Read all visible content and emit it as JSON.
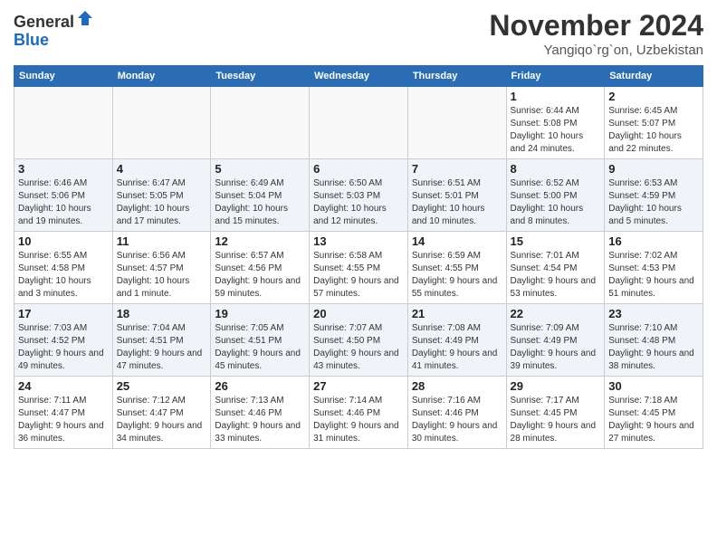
{
  "header": {
    "logo_line1": "General",
    "logo_line2": "Blue",
    "month_title": "November 2024",
    "location": "Yangiqo`rg`on, Uzbekistan"
  },
  "days_of_week": [
    "Sunday",
    "Monday",
    "Tuesday",
    "Wednesday",
    "Thursday",
    "Friday",
    "Saturday"
  ],
  "weeks": [
    [
      {
        "day": "",
        "info": ""
      },
      {
        "day": "",
        "info": ""
      },
      {
        "day": "",
        "info": ""
      },
      {
        "day": "",
        "info": ""
      },
      {
        "day": "",
        "info": ""
      },
      {
        "day": "1",
        "info": "Sunrise: 6:44 AM\nSunset: 5:08 PM\nDaylight: 10 hours and 24 minutes."
      },
      {
        "day": "2",
        "info": "Sunrise: 6:45 AM\nSunset: 5:07 PM\nDaylight: 10 hours and 22 minutes."
      }
    ],
    [
      {
        "day": "3",
        "info": "Sunrise: 6:46 AM\nSunset: 5:06 PM\nDaylight: 10 hours and 19 minutes."
      },
      {
        "day": "4",
        "info": "Sunrise: 6:47 AM\nSunset: 5:05 PM\nDaylight: 10 hours and 17 minutes."
      },
      {
        "day": "5",
        "info": "Sunrise: 6:49 AM\nSunset: 5:04 PM\nDaylight: 10 hours and 15 minutes."
      },
      {
        "day": "6",
        "info": "Sunrise: 6:50 AM\nSunset: 5:03 PM\nDaylight: 10 hours and 12 minutes."
      },
      {
        "day": "7",
        "info": "Sunrise: 6:51 AM\nSunset: 5:01 PM\nDaylight: 10 hours and 10 minutes."
      },
      {
        "day": "8",
        "info": "Sunrise: 6:52 AM\nSunset: 5:00 PM\nDaylight: 10 hours and 8 minutes."
      },
      {
        "day": "9",
        "info": "Sunrise: 6:53 AM\nSunset: 4:59 PM\nDaylight: 10 hours and 5 minutes."
      }
    ],
    [
      {
        "day": "10",
        "info": "Sunrise: 6:55 AM\nSunset: 4:58 PM\nDaylight: 10 hours and 3 minutes."
      },
      {
        "day": "11",
        "info": "Sunrise: 6:56 AM\nSunset: 4:57 PM\nDaylight: 10 hours and 1 minute."
      },
      {
        "day": "12",
        "info": "Sunrise: 6:57 AM\nSunset: 4:56 PM\nDaylight: 9 hours and 59 minutes."
      },
      {
        "day": "13",
        "info": "Sunrise: 6:58 AM\nSunset: 4:55 PM\nDaylight: 9 hours and 57 minutes."
      },
      {
        "day": "14",
        "info": "Sunrise: 6:59 AM\nSunset: 4:55 PM\nDaylight: 9 hours and 55 minutes."
      },
      {
        "day": "15",
        "info": "Sunrise: 7:01 AM\nSunset: 4:54 PM\nDaylight: 9 hours and 53 minutes."
      },
      {
        "day": "16",
        "info": "Sunrise: 7:02 AM\nSunset: 4:53 PM\nDaylight: 9 hours and 51 minutes."
      }
    ],
    [
      {
        "day": "17",
        "info": "Sunrise: 7:03 AM\nSunset: 4:52 PM\nDaylight: 9 hours and 49 minutes."
      },
      {
        "day": "18",
        "info": "Sunrise: 7:04 AM\nSunset: 4:51 PM\nDaylight: 9 hours and 47 minutes."
      },
      {
        "day": "19",
        "info": "Sunrise: 7:05 AM\nSunset: 4:51 PM\nDaylight: 9 hours and 45 minutes."
      },
      {
        "day": "20",
        "info": "Sunrise: 7:07 AM\nSunset: 4:50 PM\nDaylight: 9 hours and 43 minutes."
      },
      {
        "day": "21",
        "info": "Sunrise: 7:08 AM\nSunset: 4:49 PM\nDaylight: 9 hours and 41 minutes."
      },
      {
        "day": "22",
        "info": "Sunrise: 7:09 AM\nSunset: 4:49 PM\nDaylight: 9 hours and 39 minutes."
      },
      {
        "day": "23",
        "info": "Sunrise: 7:10 AM\nSunset: 4:48 PM\nDaylight: 9 hours and 38 minutes."
      }
    ],
    [
      {
        "day": "24",
        "info": "Sunrise: 7:11 AM\nSunset: 4:47 PM\nDaylight: 9 hours and 36 minutes."
      },
      {
        "day": "25",
        "info": "Sunrise: 7:12 AM\nSunset: 4:47 PM\nDaylight: 9 hours and 34 minutes."
      },
      {
        "day": "26",
        "info": "Sunrise: 7:13 AM\nSunset: 4:46 PM\nDaylight: 9 hours and 33 minutes."
      },
      {
        "day": "27",
        "info": "Sunrise: 7:14 AM\nSunset: 4:46 PM\nDaylight: 9 hours and 31 minutes."
      },
      {
        "day": "28",
        "info": "Sunrise: 7:16 AM\nSunset: 4:46 PM\nDaylight: 9 hours and 30 minutes."
      },
      {
        "day": "29",
        "info": "Sunrise: 7:17 AM\nSunset: 4:45 PM\nDaylight: 9 hours and 28 minutes."
      },
      {
        "day": "30",
        "info": "Sunrise: 7:18 AM\nSunset: 4:45 PM\nDaylight: 9 hours and 27 minutes."
      }
    ]
  ]
}
